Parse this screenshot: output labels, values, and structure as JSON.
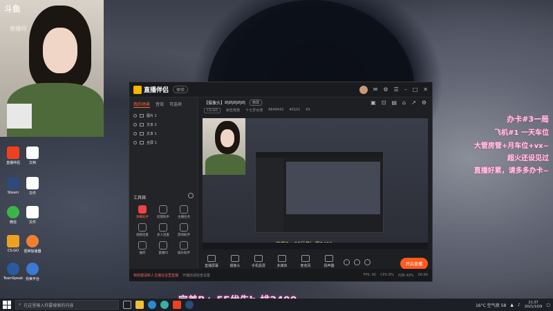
{
  "webcam": {
    "logo": "斗鱼",
    "logo_sub": "直播间"
  },
  "desktop_icons": [
    {
      "name": "dicon-1",
      "label": "直播伴侣",
      "color": "#f04020"
    },
    {
      "name": "dicon-2",
      "label": "文档",
      "color": "#ffffff"
    },
    {
      "name": "dicon-3",
      "label": "Steam",
      "color": "#2c4a7a"
    },
    {
      "name": "dicon-4",
      "label": "文件",
      "color": "#ffffff"
    },
    {
      "name": "dicon-5",
      "label": "微信",
      "color": "#3ab54a"
    },
    {
      "name": "dicon-6",
      "label": "文件",
      "color": "#ffffff"
    },
    {
      "name": "dicon-7",
      "label": "CS:GO",
      "color": "#f0a020"
    },
    {
      "name": "dicon-8",
      "label": "雷神加速器",
      "color": "#f08030"
    },
    {
      "name": "dicon-9",
      "label": "TeamSpeak",
      "color": "#2a5aa0"
    },
    {
      "name": "dicon-10",
      "label": "完美平台",
      "color": "#3a7ad0"
    }
  ],
  "app": {
    "title": "直播伴侣",
    "version": "体验",
    "tabs": [
      "我的场景",
      "音效",
      "可选项"
    ],
    "sources": [
      "图片 1",
      "文本 2",
      "文本 1",
      "全屏 1"
    ],
    "tools_label": "工具箱",
    "tools": [
      "弹幕助手",
      "房管助手",
      "主播任务",
      "视频连麦",
      "多人连麦",
      "游戏助手",
      "抽奖",
      "直播间",
      "娱乐助手",
      "",
      ""
    ],
    "room": {
      "title": "【摄像头】呜呜呜呜呜",
      "tag": "修改",
      "game": "CS:GO",
      "category": "射击竞技",
      "sub": "十七岁女孩",
      "id": "8848442",
      "heat": "40101",
      "fans": "65"
    },
    "overlay_text": "完美B+ 5E优先b-排2400",
    "controls": [
      "直播屏幕",
      "摄像头",
      "手机投屏",
      "多媒体",
      "麦克风",
      "扬声器"
    ],
    "go_live": "开启直播",
    "status": {
      "warn": "特别邀请新人主播在这里直播",
      "tip": "开播前请检查设置",
      "fps": "FPS: 60",
      "cpu": "CPU 8%",
      "mem": "内存 49%",
      "time": "00:00"
    }
  },
  "right_text": [
    "办卡#3一局",
    "飞机#1 一天车位",
    "大管房管+月车位+vx~",
    "超火还设见过",
    "直播好累，请多多办卡~"
  ],
  "bottom_banner": "完美B+ 5E优先b-排2400",
  "taskbar": {
    "search_placeholder": "在这里输入你要搜索的内容",
    "weather": "16°C 空气良 58",
    "time": "21:37",
    "date": "2021/10/9"
  }
}
